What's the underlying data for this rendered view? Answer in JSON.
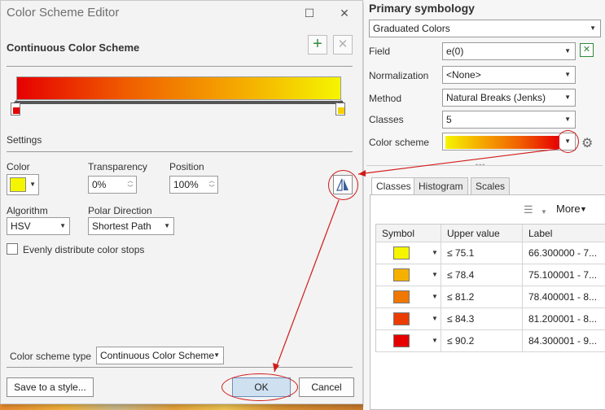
{
  "dialog": {
    "title": "Color Scheme Editor",
    "section_title": "Continuous Color Scheme",
    "settings_label": "Settings",
    "color_label": "Color",
    "color_value": "#f5f500",
    "transparency_label": "Transparency",
    "transparency_value": "0%",
    "position_label": "Position",
    "position_value": "100%",
    "algorithm_label": "Algorithm",
    "algorithm_value": "HSV",
    "polar_label": "Polar Direction",
    "polar_value": "Shortest Path",
    "evenly_label": "Evenly distribute color stops",
    "scheme_type_label": "Color scheme type",
    "scheme_type_value": "Continuous Color Scheme",
    "save_style_label": "Save to a style...",
    "ok_label": "OK",
    "cancel_label": "Cancel",
    "stops": [
      {
        "color": "#e60000",
        "position": 0
      },
      {
        "color": "#f5d000",
        "position": 100
      }
    ]
  },
  "panel": {
    "title": "Primary symbology",
    "method_select": "Graduated Colors",
    "field_label": "Field",
    "field_value": "e(0)",
    "normalization_label": "Normalization",
    "normalization_value": "<None>",
    "method_label": "Method",
    "method_value": "Natural Breaks (Jenks)",
    "classes_label": "Classes",
    "classes_value": "5",
    "color_scheme_label": "Color scheme",
    "tabs": [
      "Classes",
      "Histogram",
      "Scales"
    ],
    "more_label": "More",
    "columns": [
      "Symbol",
      "Upper value",
      "Label"
    ],
    "rows": [
      {
        "color": "#f5f500",
        "upper": "≤   75.1",
        "label": "66.300000 - 7..."
      },
      {
        "color": "#f5b000",
        "upper": "≤   78.4",
        "label": "75.100001 - 7..."
      },
      {
        "color": "#f07800",
        "upper": "≤   81.2",
        "label": "78.400001 - 8..."
      },
      {
        "color": "#eb3c00",
        "upper": "≤   84.3",
        "label": "81.200001 - 8..."
      },
      {
        "color": "#e60000",
        "upper": "≤   90.2",
        "label": "84.300001 - 9..."
      }
    ]
  }
}
